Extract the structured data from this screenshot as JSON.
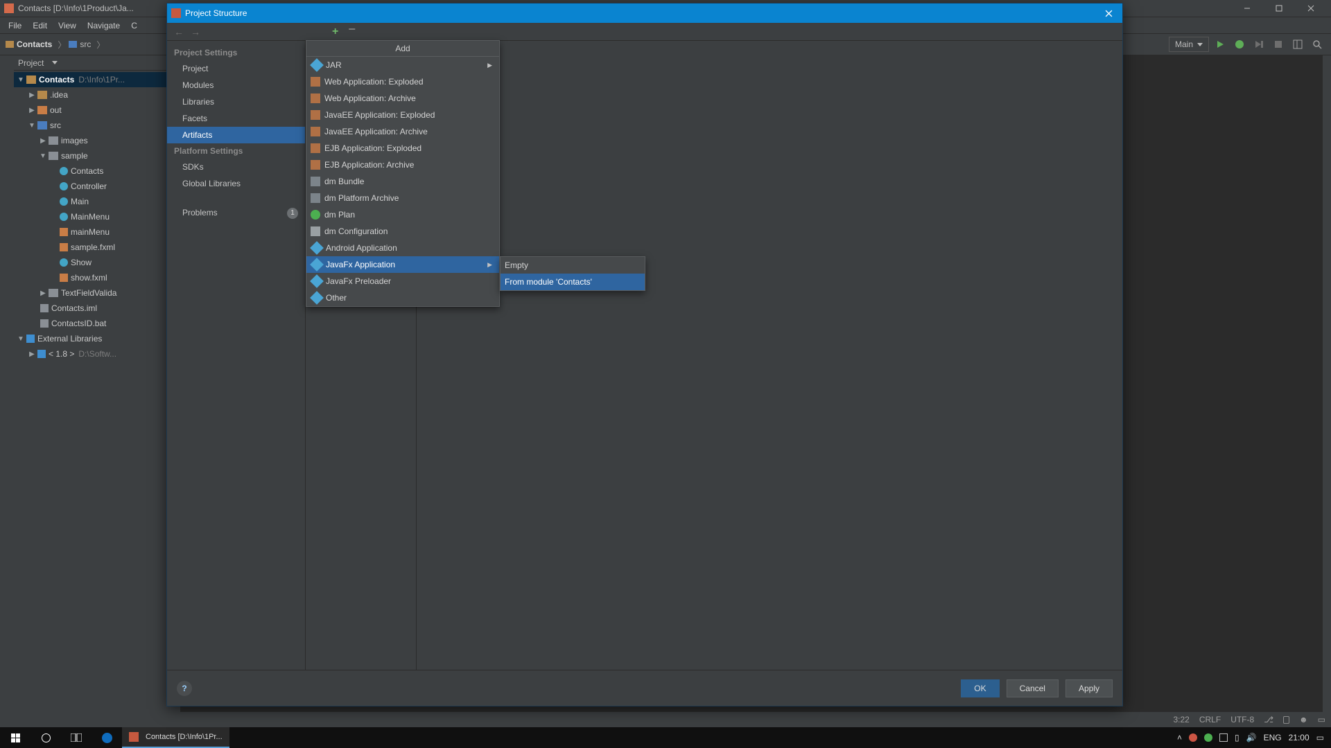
{
  "ide": {
    "title": "Contacts [D:\\Info\\1Product\\Ja...",
    "menus": [
      "File",
      "Edit",
      "View",
      "Navigate",
      "C"
    ],
    "breadcrumb": {
      "project": "Contacts",
      "src": "src"
    },
    "runConfig": "Main",
    "toolWindow": {
      "label": "Project"
    },
    "status": {
      "pos": "3:22",
      "crlf": "CRLF",
      "enc": "UTF-8"
    },
    "tree": {
      "root": {
        "name": "Contacts",
        "hint": "D:\\Info\\1Pr..."
      },
      "idea": ".idea",
      "out": "out",
      "src": "src",
      "images": "images",
      "sample": "sample",
      "files": {
        "contacts": "Contacts",
        "controller": "Controller",
        "main": "Main",
        "mainMenu": "MainMenu",
        "mainMenuFxml": "mainMenu",
        "sampleFxml": "sample.fxml",
        "show": "Show",
        "showFxml": "show.fxml"
      },
      "textFieldValidator": "TextFieldValida",
      "contactsIml": "Contacts.iml",
      "contactsIdBat": "ContactsID.bat",
      "extLib": "External Libraries",
      "jdk": "< 1.8 >",
      "jdkHint": "D:\\Softw..."
    }
  },
  "dialog": {
    "title": "Project Structure",
    "sections": {
      "ps": "Project Settings",
      "plat": "Platform Settings"
    },
    "items": {
      "project": "Project",
      "modules": "Modules",
      "libraries": "Libraries",
      "facets": "Facets",
      "artifacts": "Artifacts",
      "sdks": "SDKs",
      "globalLibs": "Global Libraries",
      "problems": "Problems",
      "problemsCount": "1"
    },
    "buttons": {
      "ok": "OK",
      "cancel": "Cancel",
      "apply": "Apply"
    }
  },
  "addMenu": {
    "title": "Add",
    "items": {
      "jar": "JAR",
      "webExploded": "Web Application: Exploded",
      "webArchive": "Web Application: Archive",
      "jeeExploded": "JavaEE Application: Exploded",
      "jeeArchive": "JavaEE Application: Archive",
      "ejbExploded": "EJB Application: Exploded",
      "ejbArchive": "EJB Application: Archive",
      "dmBundle": "dm Bundle",
      "dmPlatform": "dm Platform Archive",
      "dmPlan": "dm Plan",
      "dmConfig": "dm Configuration",
      "android": "Android Application",
      "javafx": "JavaFx Application",
      "javafxPre": "JavaFx Preloader",
      "other": "Other"
    },
    "sub": {
      "empty": "Empty",
      "fromModule": "From module 'Contacts'"
    }
  },
  "taskbar": {
    "app": "Contacts [D:\\Info\\1Pr...",
    "lang": "ENG",
    "time": "21:00"
  }
}
